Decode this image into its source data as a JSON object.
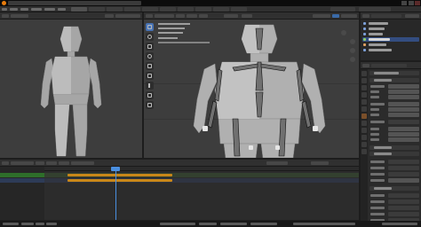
{
  "app": {
    "name": "Blender",
    "colors": {
      "accent": "#4772b3",
      "selection": "#334d80",
      "action_strip": "#c98719",
      "logo": "#e87d0d",
      "playhead": "#4a8fe0",
      "keyframe_row": "#2e6e2a"
    }
  },
  "icons": {
    "logo": "blender-logo-icon",
    "minimize": "minimize-icon",
    "maximize": "maximize-icon",
    "close": "close-icon",
    "visibility": "eye-icon",
    "armature": "bone-icon",
    "mesh": "mesh-icon",
    "camera": "camera-icon",
    "light": "light-icon"
  },
  "tools": [
    "select-icon",
    "cursor-icon",
    "move-icon",
    "rotate-icon",
    "scale-icon",
    "transform-icon",
    "annotate-icon",
    "measure-icon",
    "bone-size-icon"
  ],
  "outliner": {
    "selected_row": 3,
    "row_count": 6
  },
  "properties": {
    "active_tab": 6,
    "tab_count": 12
  },
  "timeline": {
    "strip_count": 2
  }
}
